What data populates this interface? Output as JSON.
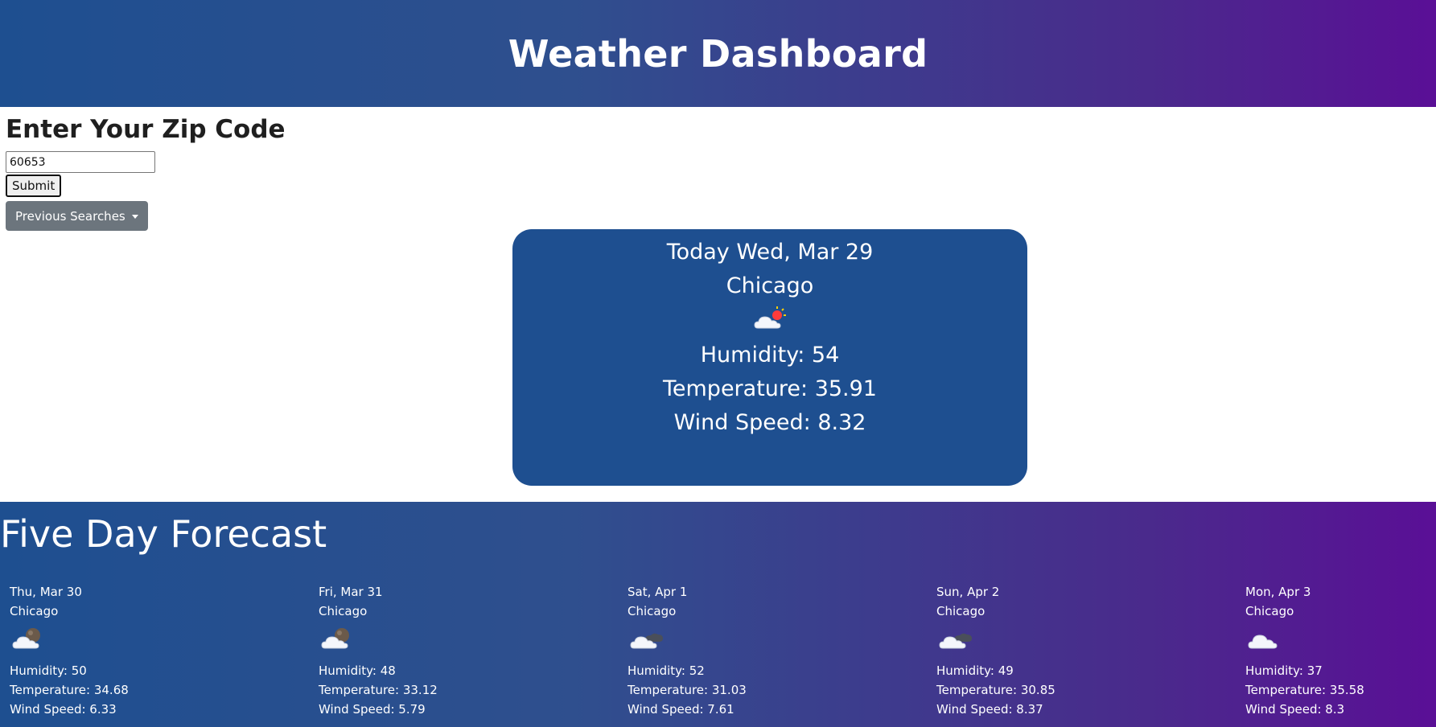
{
  "header": {
    "title": "Weather Dashboard"
  },
  "search": {
    "title": "Enter Your Zip Code",
    "zip_value": "60653",
    "submit_label": "Submit",
    "previous_label": "Previous Searches"
  },
  "today": {
    "date_line": "Today Wed, Mar 29",
    "city": "Chicago",
    "icon": "cloud-sun-icon",
    "humidity": "Humidity: 54",
    "temperature": "Temperature: 35.91",
    "wind": "Wind Speed: 8.32"
  },
  "forecast": {
    "title": "Five Day Forecast",
    "days": [
      {
        "date": "Thu, Mar 30",
        "city": "Chicago",
        "icon": "cloud-moon-icon",
        "humidity": "Humidity: 50",
        "temperature": "Temperature: 34.68",
        "wind": "Wind Speed: 6.33"
      },
      {
        "date": "Fri, Mar 31",
        "city": "Chicago",
        "icon": "cloud-moon-icon",
        "humidity": "Humidity: 48",
        "temperature": "Temperature: 33.12",
        "wind": "Wind Speed: 5.79"
      },
      {
        "date": "Sat, Apr 1",
        "city": "Chicago",
        "icon": "broken-clouds-icon",
        "humidity": "Humidity: 52",
        "temperature": "Temperature: 31.03",
        "wind": "Wind Speed: 7.61"
      },
      {
        "date": "Sun, Apr 2",
        "city": "Chicago",
        "icon": "broken-clouds-icon",
        "humidity": "Humidity: 49",
        "temperature": "Temperature: 30.85",
        "wind": "Wind Speed: 8.37"
      },
      {
        "date": "Mon, Apr 3",
        "city": "Chicago",
        "icon": "cloud-icon",
        "humidity": "Humidity: 37",
        "temperature": "Temperature: 35.58",
        "wind": "Wind Speed: 8.3"
      }
    ]
  },
  "colors": {
    "header_gradient_start": "#1e4f90",
    "header_gradient_end": "#5a0f96",
    "card_bg": "#1e4f90",
    "secondary_button": "#6c757d"
  }
}
